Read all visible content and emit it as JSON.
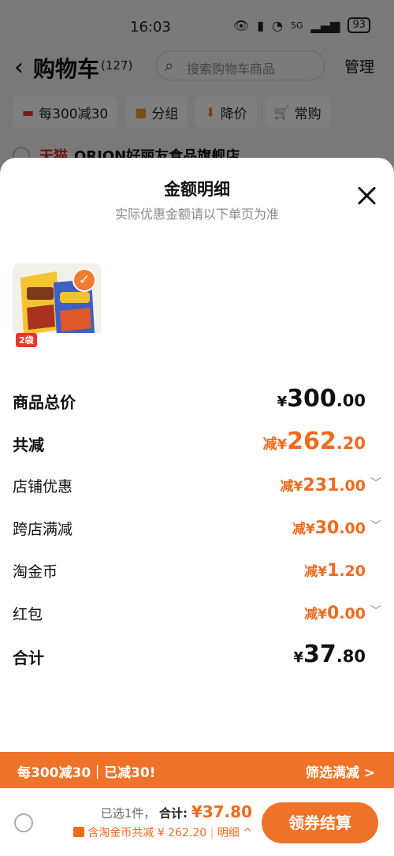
{
  "status_bar": {
    "time": "16:03",
    "network": "5G",
    "battery": "93"
  },
  "header": {
    "back_icon": "chevron-left-icon",
    "title": "购物车",
    "count": "(127)",
    "search_placeholder": "搜索购物车商品",
    "manage": "管理"
  },
  "chips": [
    {
      "icon": "coupon-icon",
      "label": "每300减30"
    },
    {
      "icon": "folder-icon",
      "label": "分组"
    },
    {
      "icon": "arrow-down-icon",
      "label": "降价"
    },
    {
      "icon": "cart-icon",
      "label": "常购"
    }
  ],
  "store": {
    "platform": "天猫",
    "name": "ORION好丽友食品旗舰店"
  },
  "sheet": {
    "title": "金额明细",
    "subtitle": "实际优惠金额请以下单页为准",
    "product": {
      "tag": "2袋",
      "selected": true
    },
    "rows": [
      {
        "label": "商品总价",
        "prefix": "¥",
        "int": "300",
        "dec": ".00",
        "style": "total"
      },
      {
        "label": "共减",
        "prefix": "减¥",
        "int": "262",
        "dec": ".20",
        "style": "discount-total"
      },
      {
        "label": "店铺优惠",
        "prefix": "减¥",
        "int": "231",
        "dec": ".00",
        "expandable": true
      },
      {
        "label": "跨店满减",
        "prefix": "减¥",
        "int": "30",
        "dec": ".00",
        "expandable": true
      },
      {
        "label": "淘金币",
        "prefix": "减¥",
        "int": "1",
        "dec": ".20",
        "expandable": false
      },
      {
        "label": "红包",
        "prefix": "减¥",
        "int": "0",
        "dec": ".00",
        "expandable": true
      },
      {
        "label": "合计",
        "prefix": "¥",
        "int": "37",
        "dec": ".80",
        "style": "total"
      }
    ]
  },
  "promo_bar": {
    "left": "每300减30｜已减30!",
    "right": "筛选满减 >"
  },
  "bottom": {
    "selected_count": "已选1件，",
    "total_label": "合计:",
    "total_value": "¥37.80",
    "deduct_text": "含淘金币共减 ¥ 262.20",
    "detail_link": "明细 ^",
    "checkout": "领券结算"
  },
  "colors": {
    "accent": "#ee7227",
    "discount": "#f06a1e"
  }
}
